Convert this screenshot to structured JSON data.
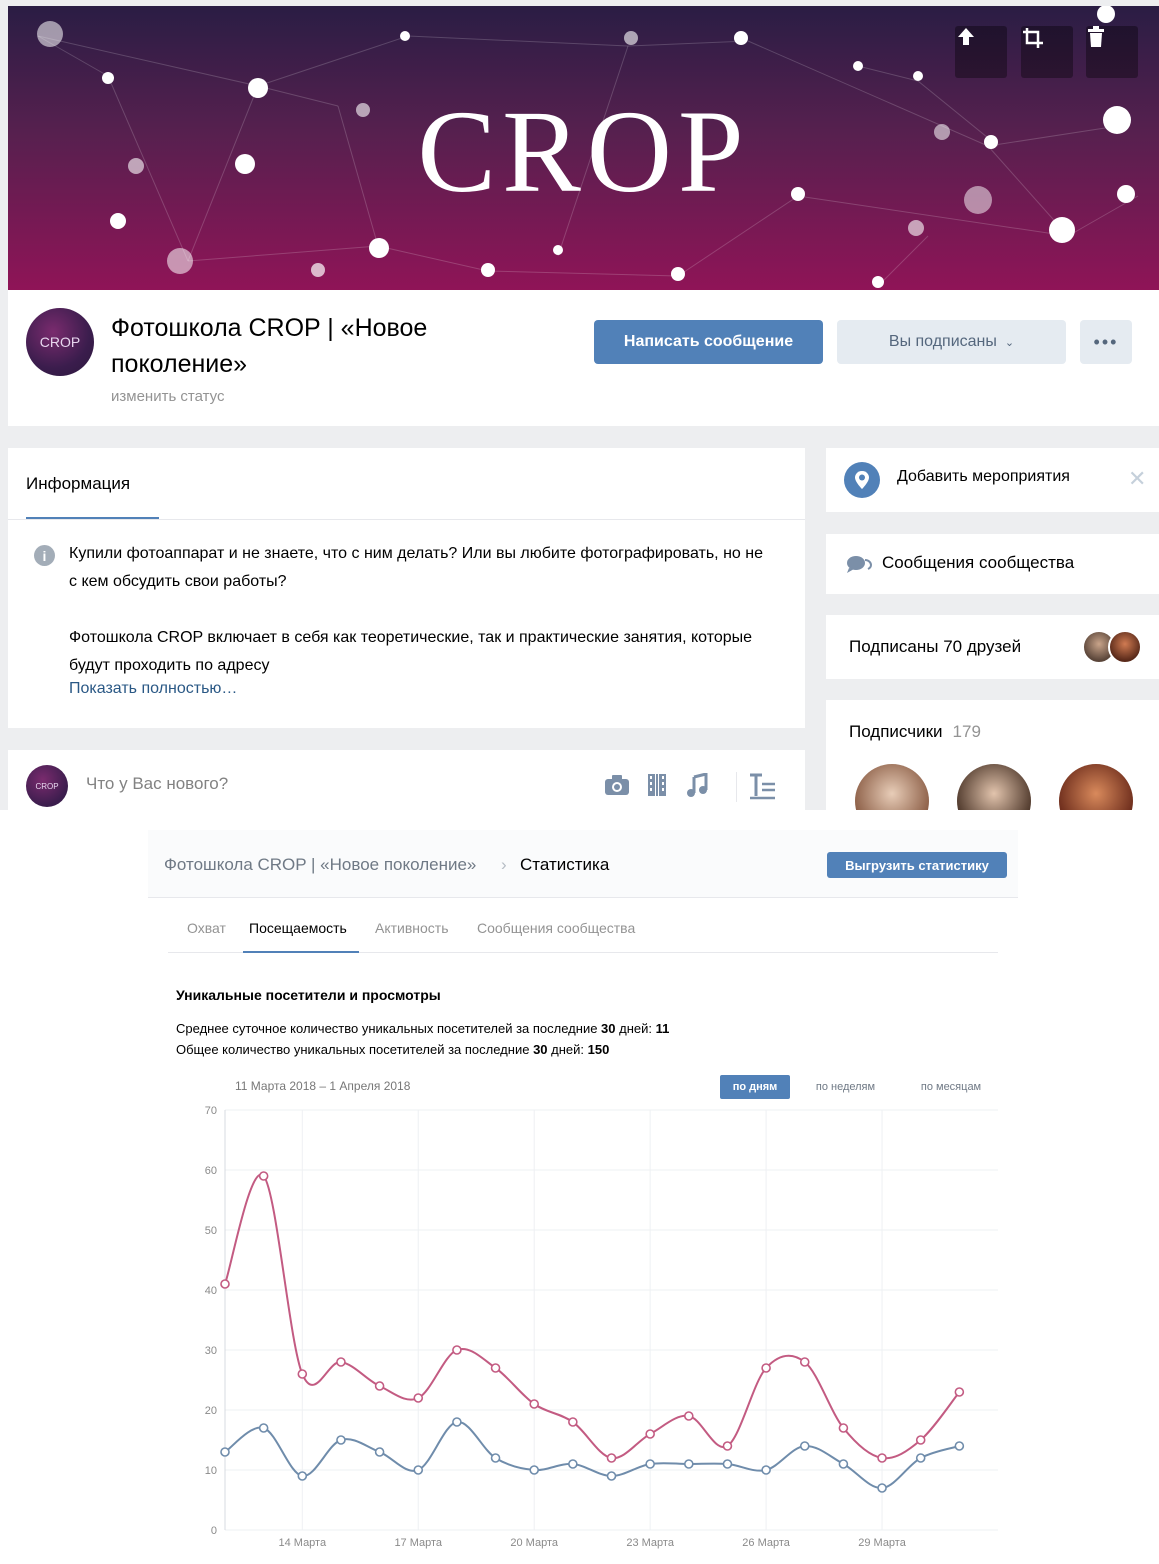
{
  "group": {
    "cover_logo": "CROP",
    "avatar_text": "CROP",
    "title": "Фотошкола CROP | «Новое поколение»",
    "status_link": "изменить статус",
    "buttons": {
      "write_message": "Написать сообщение",
      "subscribed": "Вы подписаны",
      "more": "•••"
    }
  },
  "cover_actions": [
    "upload-icon",
    "crop-icon",
    "trash-icon"
  ],
  "info": {
    "tab": "Информация",
    "paragraph1": "Купили фотоаппарат и не знаете, что с ним делать? Или вы любите фотографировать, но не с кем обсудить свои работы?",
    "paragraph2": "Фотошкола CROP включает в себя как теоретические, так и практические занятия, которые будут проходить по адресу",
    "show_more": "Показать полностью…"
  },
  "composer": {
    "placeholder": "Что у Вас нового?",
    "icons": [
      "camera-icon",
      "video-icon",
      "music-icon",
      "text-format-icon"
    ]
  },
  "sidebar": {
    "add_events": "Добавить мероприятия",
    "community_messages": "Сообщения сообщества",
    "friends_subscribed": "Подписаны 70 друзей",
    "subscribers_label": "Подписчики",
    "subscribers_count": "179"
  },
  "stats": {
    "breadcrumb_group": "Фотошкола CROP | «Новое поколение»",
    "breadcrumb_sep": "›",
    "breadcrumb_page": "Статистика",
    "export_button": "Выгрузить статистику",
    "tabs": [
      "Охват",
      "Посещаемость",
      "Активность",
      "Сообщения сообщества"
    ],
    "active_tab": "Посещаемость",
    "section_title": "Уникальные посетители и просмотры",
    "avg_text": "Среднее суточное количество уникальных посетителей за последние ",
    "avg_days": "30",
    "avg_suffix": " дней: ",
    "avg_value": "11",
    "total_text": "Общее количество уникальных посетителей за последние ",
    "total_days": "30",
    "total_suffix": " дней: ",
    "total_value": "150",
    "date_range": "11 Марта 2018 – 1 Апреля 2018",
    "periods": [
      "по дням",
      "по неделям",
      "по месяцам"
    ]
  },
  "chart_data": {
    "type": "line",
    "x": [
      "12 Марта",
      "13 Марта",
      "14 Марта",
      "15 Марта",
      "16 Марта",
      "17 Марта",
      "18 Марта",
      "19 Марта",
      "20 Марта",
      "21 Марта",
      "22 Марта",
      "23 Марта",
      "24 Марта",
      "25 Марта",
      "26 Марта",
      "27 Марта",
      "28 Марта",
      "29 Марта",
      "30 Марта",
      "31 Марта",
      "1 Апреля"
    ],
    "tick_labels": [
      "14 Марта",
      "17 Марта",
      "20 Марта",
      "23 Марта",
      "26 Марта",
      "29 Марта"
    ],
    "ylim": [
      0,
      70
    ],
    "yticks": [
      0,
      10,
      20,
      30,
      40,
      50,
      60,
      70
    ],
    "grid": true,
    "series": [
      {
        "color": "#c35b82",
        "values": [
          41,
          59,
          26,
          28,
          24,
          22,
          30,
          27,
          21,
          18,
          12,
          16,
          19,
          14,
          27,
          28,
          17,
          12,
          15,
          23
        ]
      },
      {
        "color": "#6f8cab",
        "values": [
          13,
          17,
          9,
          15,
          13,
          10,
          18,
          12,
          10,
          11,
          9,
          11,
          11,
          11,
          10,
          14,
          11,
          7,
          12,
          14
        ]
      }
    ]
  },
  "colors": {
    "accent": "#5181b8",
    "cover_dark": "#2a1d44",
    "cover_magenta": "#8f1457",
    "page_bg": "#edeef0"
  }
}
